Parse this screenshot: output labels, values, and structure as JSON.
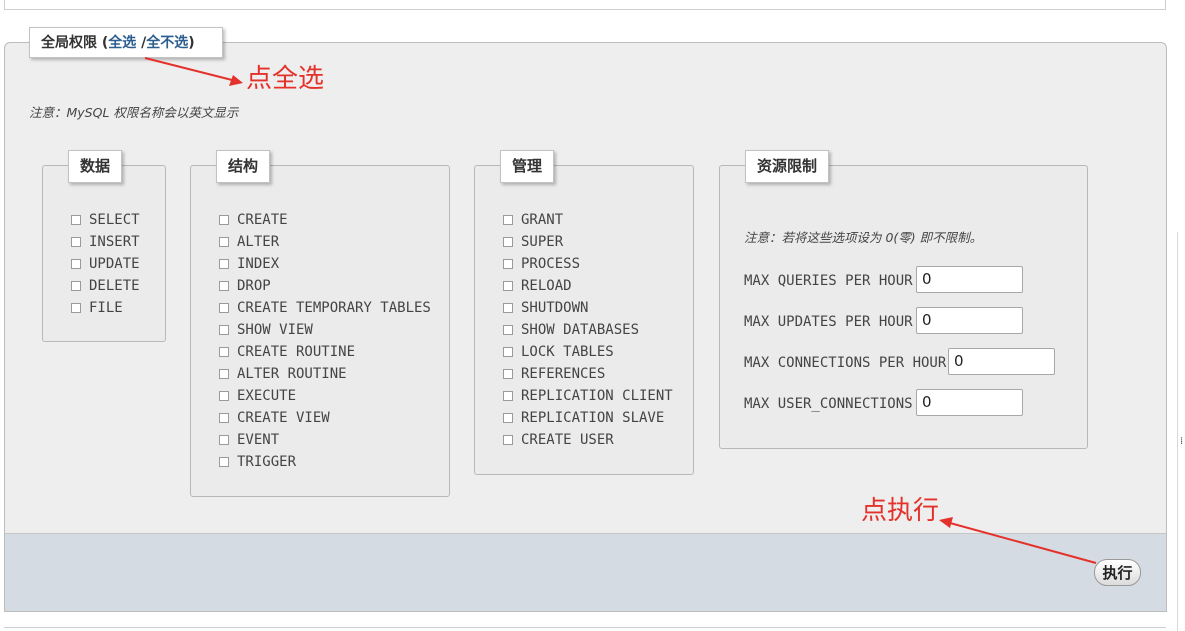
{
  "legend": {
    "title": "全局权限",
    "open_paren": "(",
    "select_all": "全选",
    "separator": "/",
    "select_none": "全不选",
    "close_paren": ")"
  },
  "note": "注意：MySQL 权限名称会以英文显示",
  "annotations": {
    "select_all_hint": "点全选",
    "execute_hint": "点执行"
  },
  "groups": {
    "data": {
      "title": "数据",
      "items": [
        "SELECT",
        "INSERT",
        "UPDATE",
        "DELETE",
        "FILE"
      ]
    },
    "structure": {
      "title": "结构",
      "items": [
        "CREATE",
        "ALTER",
        "INDEX",
        "DROP",
        "CREATE TEMPORARY TABLES",
        "SHOW VIEW",
        "CREATE ROUTINE",
        "ALTER ROUTINE",
        "EXECUTE",
        "CREATE VIEW",
        "EVENT",
        "TRIGGER"
      ]
    },
    "admin": {
      "title": "管理",
      "items": [
        "GRANT",
        "SUPER",
        "PROCESS",
        "RELOAD",
        "SHUTDOWN",
        "SHOW DATABASES",
        "LOCK TABLES",
        "REFERENCES",
        "REPLICATION CLIENT",
        "REPLICATION SLAVE",
        "CREATE USER"
      ]
    },
    "resources": {
      "title": "资源限制",
      "note": "注意：若将这些选项设为 0(零) 即不限制。",
      "limits": [
        {
          "label": "MAX QUERIES PER HOUR",
          "value": "0"
        },
        {
          "label": "MAX UPDATES PER HOUR",
          "value": "0"
        },
        {
          "label": "MAX CONNECTIONS PER HOUR",
          "value": "0"
        },
        {
          "label": "MAX USER_CONNECTIONS",
          "value": "0"
        }
      ]
    }
  },
  "execute_button": "执行",
  "colors": {
    "annotation": "#e4312b",
    "link": "#2b5d8f",
    "panel_bg": "#eeeeee",
    "footer_bg": "#d5dbe2"
  }
}
